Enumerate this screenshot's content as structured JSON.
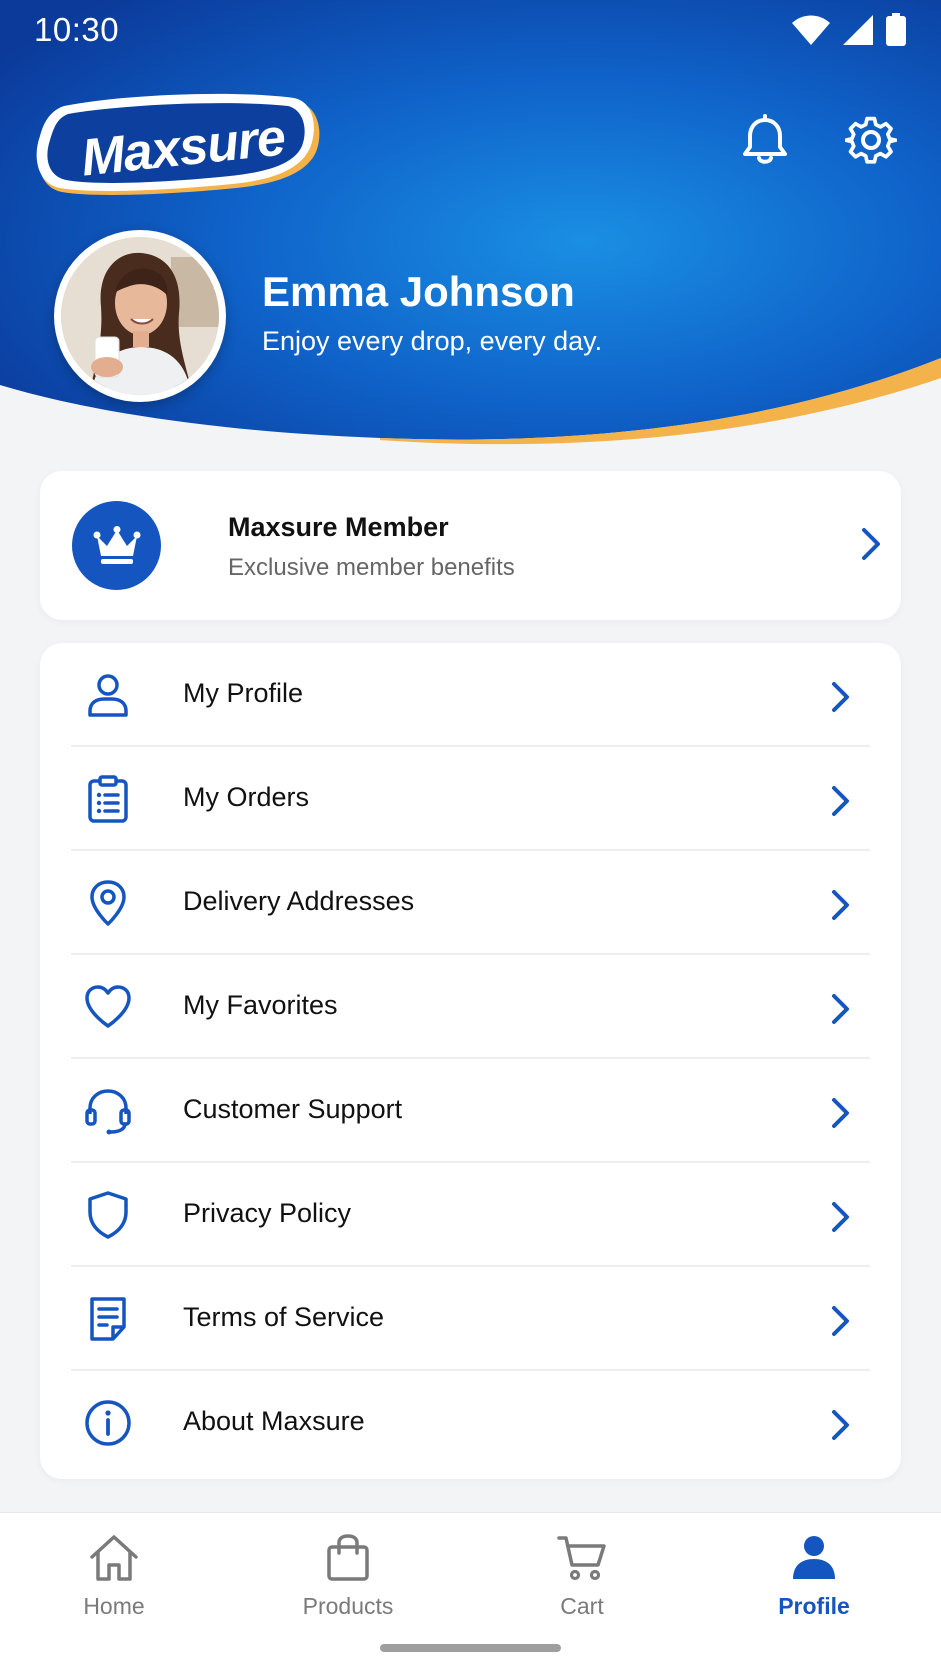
{
  "status_bar": {
    "time": "10:30"
  },
  "brand": {
    "name": "Maxsure",
    "primary_color": "#1455c0",
    "accent_color": "#f4b24a"
  },
  "header": {
    "icons": [
      "bell-icon",
      "gear-icon"
    ]
  },
  "user": {
    "name": "Emma Johnson",
    "tagline": "Enjoy every drop, every day."
  },
  "membership": {
    "title": "Maxsure Member",
    "subtitle": "Exclusive member benefits",
    "icon": "crown-icon"
  },
  "menu": {
    "items": [
      {
        "label": "My Profile",
        "icon": "user-icon"
      },
      {
        "label": "My Orders",
        "icon": "clipboard-list-icon"
      },
      {
        "label": "Delivery Addresses",
        "icon": "location-pin-icon"
      },
      {
        "label": "My Favorites",
        "icon": "heart-icon"
      },
      {
        "label": "Customer Support",
        "icon": "headset-icon"
      },
      {
        "label": "Privacy Policy",
        "icon": "shield-icon"
      },
      {
        "label": "Terms of Service",
        "icon": "document-icon"
      },
      {
        "label": "About Maxsure",
        "icon": "info-icon"
      }
    ]
  },
  "bottom_nav": {
    "items": [
      {
        "label": "Home",
        "icon": "home-icon"
      },
      {
        "label": "Products",
        "icon": "shopping-bag-icon"
      },
      {
        "label": "Cart",
        "icon": "cart-icon"
      },
      {
        "label": "Profile",
        "icon": "profile-icon"
      }
    ],
    "active": "Profile"
  }
}
